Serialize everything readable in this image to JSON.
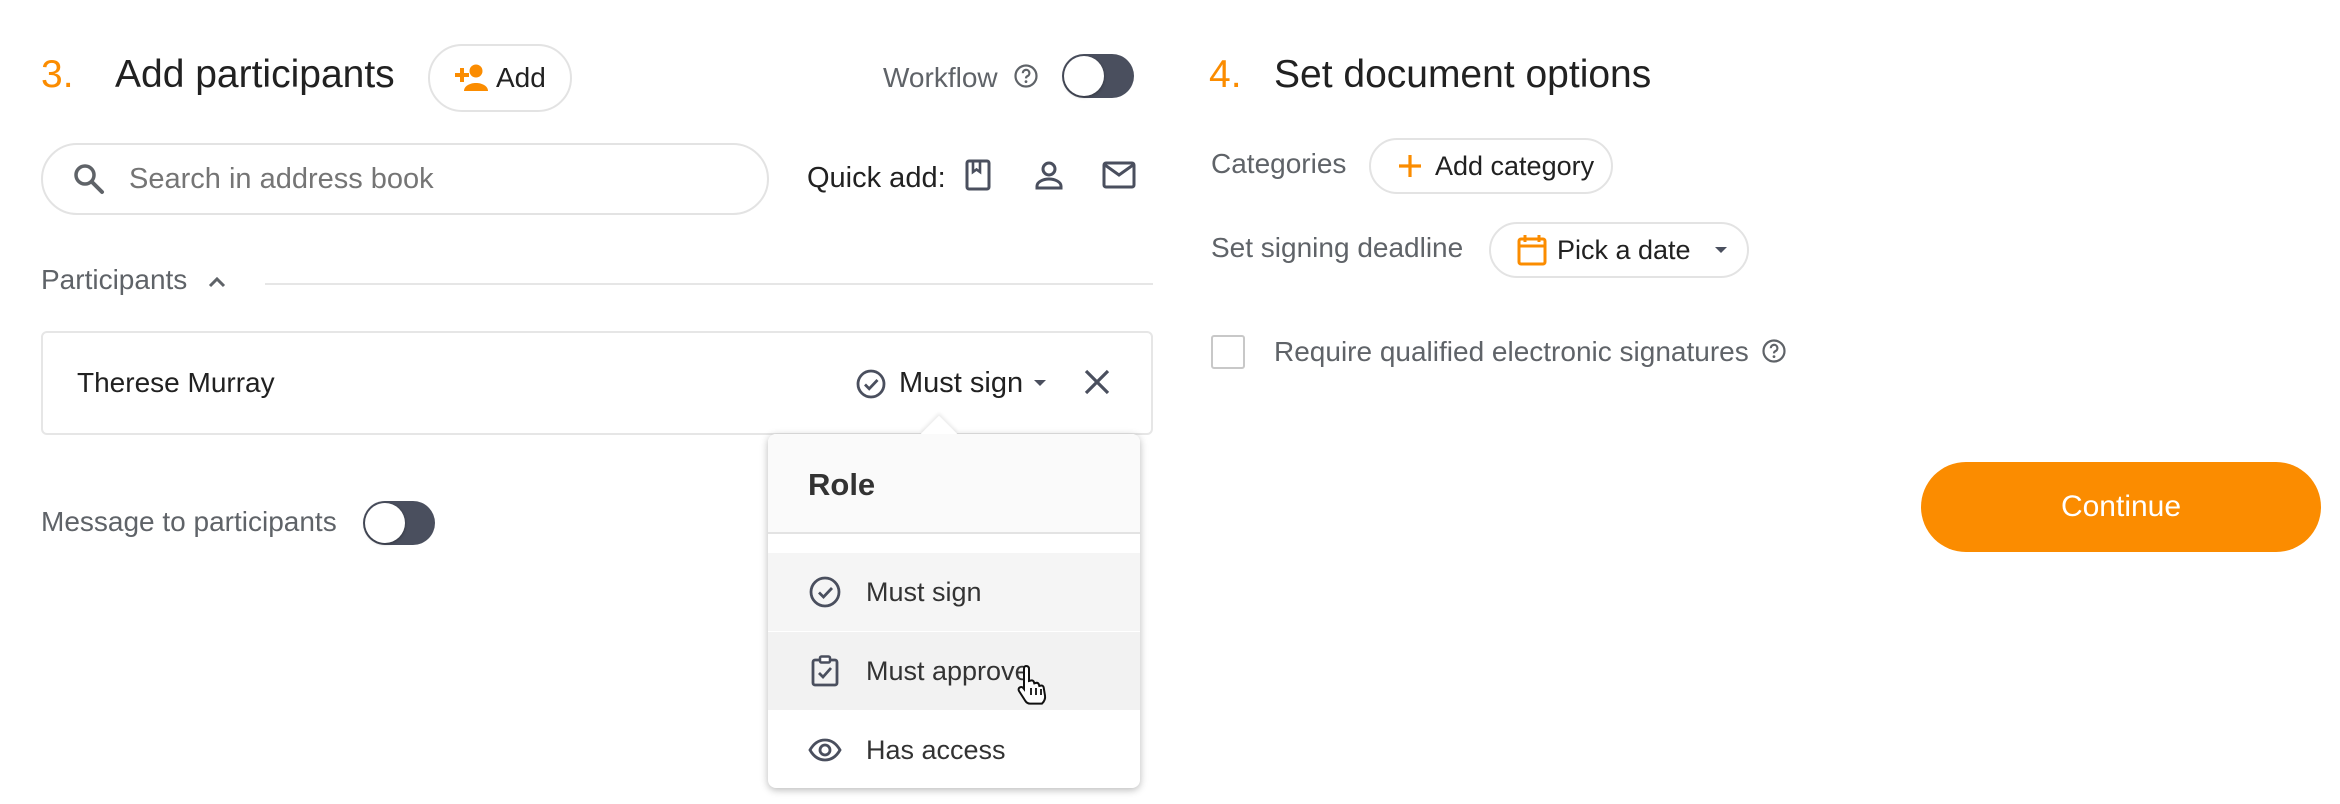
{
  "section3": {
    "number": "3.",
    "title": "Add participants",
    "add_label": "Add",
    "workflow_label": "Workflow",
    "search_placeholder": "Search in address book",
    "quick_add_label": "Quick add:",
    "participants_label": "Participants",
    "participant": {
      "name": "Therese Murray",
      "role": "Must sign"
    },
    "message_label": "Message to participants"
  },
  "role_menu": {
    "title": "Role",
    "items": [
      {
        "label": "Must sign",
        "icon": "check-circle-icon"
      },
      {
        "label": "Must approve",
        "icon": "clipboard-check-icon"
      },
      {
        "label": "Has access",
        "icon": "eye-icon"
      }
    ]
  },
  "section4": {
    "number": "4.",
    "title": "Set document options",
    "categories_label": "Categories",
    "add_category_label": "Add category",
    "deadline_label": "Set signing deadline",
    "pick_date_label": "Pick a date",
    "qualified_label": "Require qualified electronic signatures"
  },
  "continue_label": "Continue",
  "colors": {
    "accent": "#fb8c00",
    "toggle_off": "#4a4f5e"
  }
}
